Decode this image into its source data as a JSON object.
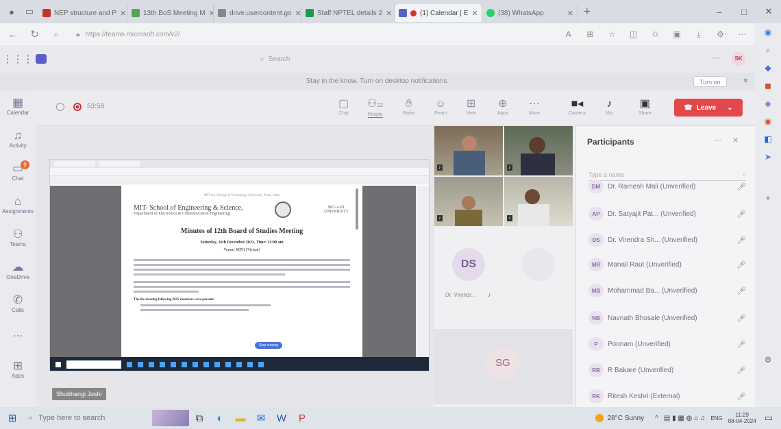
{
  "browser": {
    "tabs": [
      {
        "label": "NEP structure and P",
        "active": false,
        "fav": "#c5342b"
      },
      {
        "label": "13th BoS Meeting M",
        "active": false,
        "fav": "#5aa05a"
      },
      {
        "label": "drive.usercontent.go",
        "active": false,
        "fav": "#888888"
      },
      {
        "label": "Staff NPTEL details 2",
        "active": false,
        "fav": "#1a9b4d"
      },
      {
        "label": "(1) Calendar | E",
        "active": true,
        "fav": "#5b5fc7"
      },
      {
        "label": "(38) WhatsApp",
        "active": false,
        "fav": "#25d366"
      }
    ],
    "new_tab": "+",
    "url": "https://teams.microsoft.com/v2/",
    "window_min": "–",
    "window_max": "□",
    "window_close": "✕"
  },
  "teams": {
    "search_placeholder": "Search",
    "user_initials": "SK",
    "notification_text": "Stay in the know. Turn on desktop notifications.",
    "turn_on_label": "Turn on",
    "rail": [
      {
        "label": "Calendar",
        "icon": "calendar-icon"
      },
      {
        "label": "Activity",
        "icon": "bell-icon"
      },
      {
        "label": "Chat",
        "icon": "chat-icon",
        "badge": "9"
      },
      {
        "label": "Assignments",
        "icon": "assignments-icon"
      },
      {
        "label": "Teams",
        "icon": "teams-icon"
      },
      {
        "label": "OneDrive",
        "icon": "cloud-icon"
      },
      {
        "label": "Calls",
        "icon": "phone-icon"
      },
      {
        "label": "...",
        "icon": "more-icon"
      },
      {
        "label": "Apps",
        "icon": "apps-icon"
      }
    ]
  },
  "meeting": {
    "timer": "53:58",
    "tools": [
      {
        "label": "Chat",
        "icon": "chat-icon"
      },
      {
        "label": "People",
        "icon": "people-icon",
        "count": "22"
      },
      {
        "label": "Raise",
        "icon": "hand-icon"
      },
      {
        "label": "React",
        "icon": "smile-icon"
      },
      {
        "label": "View",
        "icon": "view-icon"
      },
      {
        "label": "Apps",
        "icon": "apps-icon"
      },
      {
        "label": "More",
        "icon": "more-icon"
      },
      {
        "label": "Camera",
        "icon": "camera-icon"
      },
      {
        "label": "Mic",
        "icon": "mic-icon"
      },
      {
        "label": "Share",
        "icon": "share-icon"
      }
    ],
    "leave_label": "Leave",
    "presenter_name": "Shubhangi Joshi",
    "tiles": [
      {
        "initials": "DS",
        "name": "Dr. Virendr..."
      },
      {
        "initials": "SG",
        "name": ""
      }
    ]
  },
  "shared_doc": {
    "institute_small": "MIT Art, Design & Technology University, Pune, India",
    "school": "MIT- School of Engineering & Science,",
    "department": "Department of Electronics & Communication Engineering",
    "logo_text": "MIT-ADT UNIVERSITY",
    "heading": "Minutes of 12th Board of Studies Meeting",
    "date_line": "Saturday, 16th December 2023, Time: 11:00 am",
    "venue": "Venue: MPH (Virtual)",
    "list_heading": "The the meeting following BOS members were present:",
    "present_badge": "Stop sharing"
  },
  "participants": {
    "title": "Participants",
    "search_placeholder": "Type a name",
    "list": [
      {
        "initials": "DM",
        "name": "Dr. Ramesh Mali (Unverified)"
      },
      {
        "initials": "AP",
        "name": "Dr. Satyajit Pat... (Unverified)"
      },
      {
        "initials": "DS",
        "name": "Dr. Virendra Sh... (Unverified)"
      },
      {
        "initials": "MR",
        "name": "Manali Raut (Unverified)"
      },
      {
        "initials": "MB",
        "name": "Mohammad Ba... (Unverified)"
      },
      {
        "initials": "NB",
        "name": "Navnath Bhosale (Unverified)"
      },
      {
        "initials": "P",
        "name": "Poonam (Unverified)"
      },
      {
        "initials": "RB",
        "name": "R Bakare (Unverified)"
      },
      {
        "initials": "RK",
        "name": "Ritesh Keshri (External)"
      }
    ]
  },
  "taskbar": {
    "search_placeholder": "Type here to search",
    "weather": "28°C Sunny",
    "lang": "ENG",
    "time": "11:29",
    "date": "08-04-2024"
  },
  "colors": {
    "leave": "#e2474b",
    "teams_accent": "#5b5fc7",
    "record": "#d13438"
  }
}
